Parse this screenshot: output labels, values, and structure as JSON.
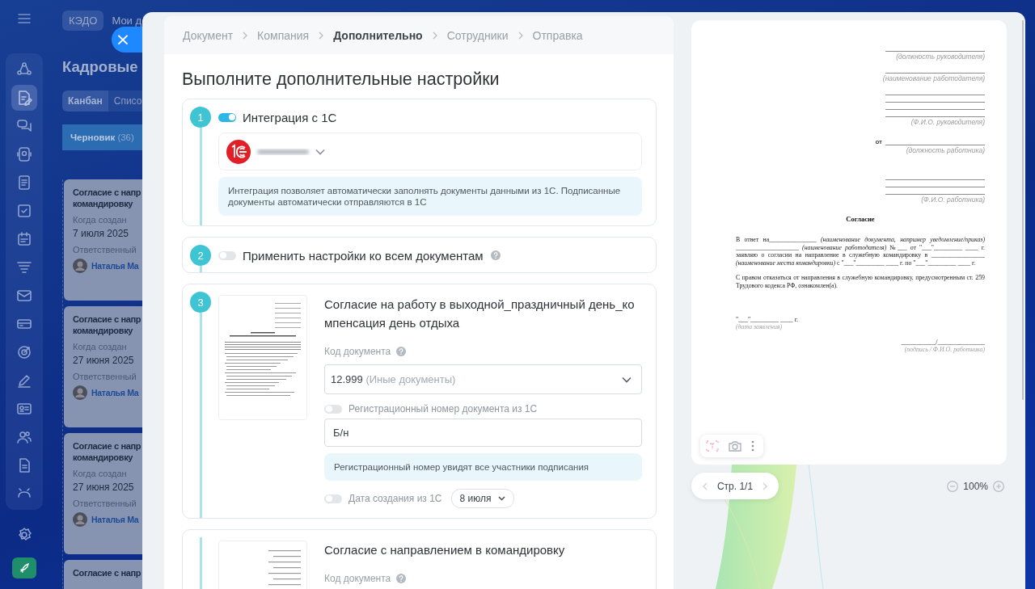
{
  "background": {
    "top_tabs": [
      {
        "label": "КЭДО",
        "selected": true
      },
      {
        "label": "Мои д",
        "selected": false
      }
    ],
    "title": "Кадровые",
    "view_tabs": [
      {
        "label": "Канбан",
        "selected": true
      },
      {
        "label": "Списо",
        "selected": false
      }
    ],
    "column": {
      "name": "Черновик",
      "count": "(36)"
    },
    "cards": [
      {
        "title_lines": [
          "Согласие с напр",
          "командировку"
        ],
        "created_label": "Когда создан",
        "created": "7 июля 2025",
        "owner_label": "Ответственный",
        "owner": "Наталья Ма"
      },
      {
        "title_lines": [
          "Согласие с напр",
          "командировку"
        ],
        "created_label": "Когда создан",
        "created": "27 июня 2025",
        "owner_label": "Ответственный",
        "owner": "Наталья Ма"
      },
      {
        "title_lines": [
          "Согласие с напр",
          "командировку"
        ],
        "created_label": "Когда создан",
        "created": "27 июня 2025",
        "owner_label": "Ответственный",
        "owner": "Наталья Ма"
      },
      {
        "title_lines": [
          "Согласие с напр"
        ]
      }
    ]
  },
  "close_button": {
    "label": "×"
  },
  "breadcrumb": [
    {
      "label": "Документ",
      "selected": false
    },
    {
      "label": "Компания",
      "selected": false
    },
    {
      "label": "Дополнительно",
      "selected": true
    },
    {
      "label": "Сотрудники",
      "selected": false
    },
    {
      "label": "Отправка",
      "selected": false
    }
  ],
  "heading": "Выполните дополнительные настройки",
  "steps": [
    {
      "kind": "integration",
      "number": "1",
      "toggle": {
        "label": "Интеграция с 1С",
        "on": true
      },
      "info": "Интеграция позволяет автоматически заполнять документы данными из 1С. Подписанные документы автоматически отправляются в 1С"
    },
    {
      "kind": "apply_all",
      "number": "2",
      "toggle": {
        "label": "Применить настройки ко всем документам",
        "on": false
      }
    },
    {
      "kind": "document",
      "number": "3",
      "title": "Согласие на работу в выходной_праздничный день_компенсация день отдыха",
      "code_label": "Код документа",
      "code_value": "12.999",
      "code_hint": "(Иные документы)",
      "reg_toggle": {
        "label": "Регистрационный номер документа из 1С",
        "on": false
      },
      "reg_number": "Б/н",
      "reg_info": "Регистрационный номер увидят все участники подписания",
      "date_toggle": {
        "label": "Дата создания из 1С",
        "on": false
      },
      "date": "8 июля"
    },
    {
      "kind": "document",
      "title": "Согласие с направлением в командировку",
      "code_label": "Код документа"
    }
  ],
  "preview": {
    "header": [
      {
        "kind": "line"
      },
      {
        "kind": "caption",
        "text": "(должность руководителя)"
      },
      {
        "kind": "line"
      },
      {
        "kind": "caption",
        "text": "(наименование работодателя)"
      },
      {
        "kind": "line"
      },
      {
        "kind": "line"
      },
      {
        "kind": "line"
      },
      {
        "kind": "line"
      },
      {
        "kind": "caption",
        "text": "(Ф.И.О. руководителя)"
      },
      {
        "kind": "prefixed_line",
        "prefix": "от"
      },
      {
        "kind": "caption",
        "text": "(должность работника)"
      },
      {
        "kind": "spacer"
      },
      {
        "kind": "line"
      },
      {
        "kind": "line"
      },
      {
        "kind": "line"
      },
      {
        "kind": "caption",
        "text": "(Ф.И.О. работника)"
      }
    ],
    "title": "Согласие",
    "paragraphs": [
      "В ответ на_______________ *(наименование документа, например уведомление/приказ)* ____________________ *(наименование работодателя)* №___ от \"___\"_________ ____ г. заявляю о согласии на направление в служебную командировку в _________________ *(наименование места командировки)* с \"___\"_________ ____ г. по \"___\"_________ ____ г.",
      "С правом отказаться от направления в служебную командировку, предусмотренным ст. 259 Трудового кодекса РФ, ознакомлен(а)."
    ],
    "date": "\"___\"_________ ____ г.",
    "date_caption": "(дата заявления)",
    "signature": "___________/_______________",
    "signature_caption": "(подпись / Ф.И.О. работника)"
  },
  "pager": {
    "label": "Стр. 1/1"
  },
  "zoom": {
    "value": "100%"
  }
}
